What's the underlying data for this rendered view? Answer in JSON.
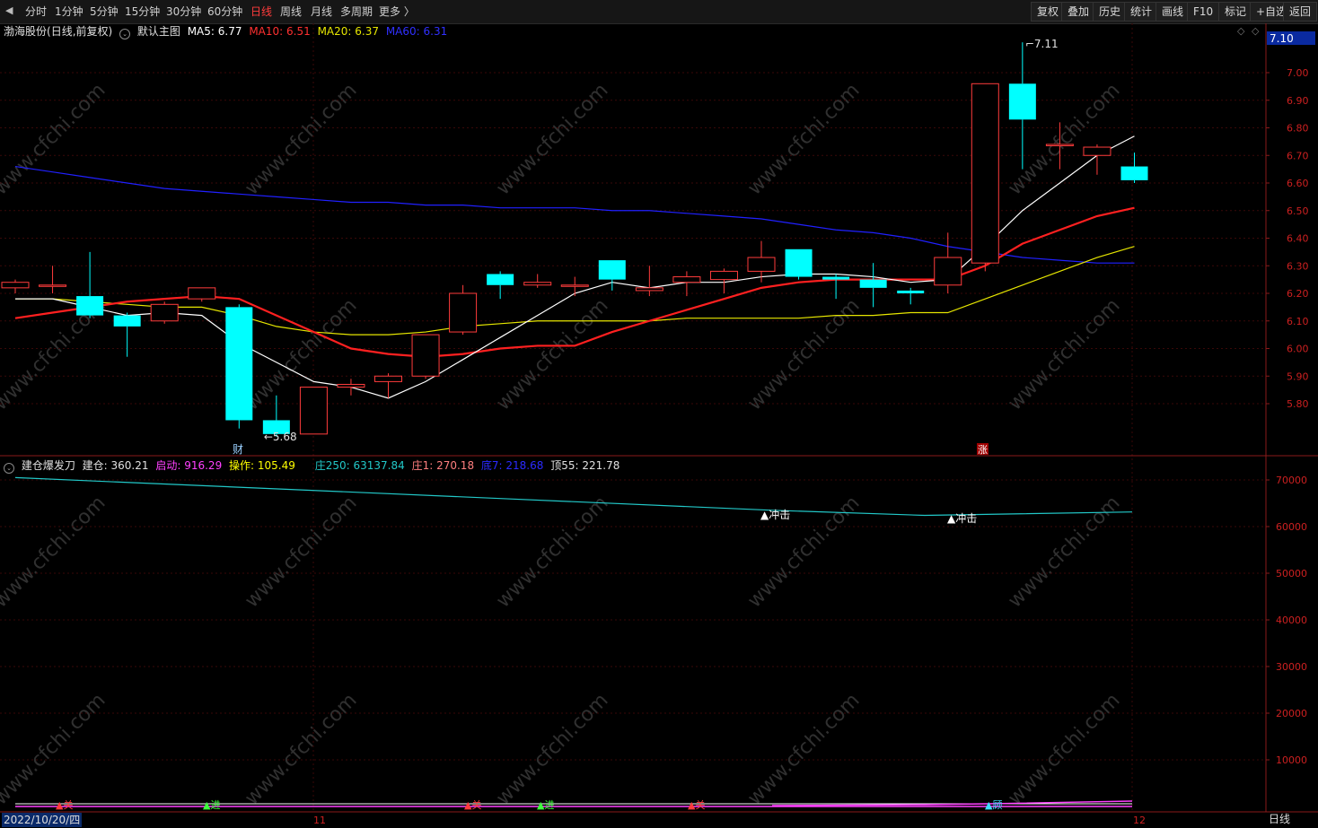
{
  "toolbar": {
    "back_icon": "triangle-left-icon",
    "periods": [
      "分时",
      "1分钟",
      "5分钟",
      "15分钟",
      "30分钟",
      "60分钟",
      "日线",
      "周线",
      "月线",
      "多周期",
      "更多 〉"
    ],
    "active_period": "日线",
    "right_buttons": [
      "复权",
      "叠加",
      "历史",
      "统计",
      "画线",
      "F10",
      "标记",
      "+自选",
      "返回"
    ]
  },
  "main_legend": {
    "stock": "渤海股份",
    "mode": "(日线,前复权)",
    "template": "默认主图",
    "ma5": "MA5: 6.77",
    "ma10": "MA10: 6.51",
    "ma20": "MA20: 6.37",
    "ma60": "MA60: 6.31"
  },
  "sub_legend": {
    "name": "建仓爆发刀",
    "jiancang": "建仓: 360.21",
    "qidong": "启动: 916.29",
    "caozuo": "操作: 105.49",
    "zhuang250": "庄250: 63137.84",
    "zhuang1": "庄1: 270.18",
    "di7": "底7: 218.68",
    "ding55": "顶55: 221.78"
  },
  "colors": {
    "up": "#ff3c3c",
    "down": "#00ffff",
    "ma5": "#ffffff",
    "ma10": "#ff2020",
    "ma20": "#e6e600",
    "ma60": "#2020ff",
    "axis": "#8a1a1a",
    "grid": "#3a0808",
    "zhuang250": "#22c8c8",
    "qidong": "#ff40ff",
    "caozuo": "#ffff00"
  },
  "price_axis": {
    "ticks": [
      "7.00",
      "6.90",
      "6.80",
      "6.70",
      "6.60",
      "6.50",
      "6.40",
      "6.30",
      "6.20",
      "6.10",
      "6.00",
      "5.90",
      "5.80"
    ],
    "current": "7.10"
  },
  "sub_axis": {
    "ticks": [
      "70000",
      "60000",
      "50000",
      "40000",
      "30000",
      "20000",
      "10000"
    ]
  },
  "annotations": {
    "high": "7.11",
    "low": "5.68",
    "cai": "财",
    "zhang": "涨",
    "chongji": "▲冲击"
  },
  "bottom_markers": [
    "▲关",
    "▲进",
    "▲关",
    "▲进",
    "▲关",
    "▲顾"
  ],
  "watermark": "www.cfchi.com",
  "date_axis": {
    "start": "2022/10/20/四",
    "nov": "11",
    "dec": "12"
  },
  "period_label": "日线",
  "chart_data": {
    "type": "candlestick",
    "candles": [
      {
        "o": 6.22,
        "c": 6.24,
        "h": 6.25,
        "l": 6.2
      },
      {
        "o": 6.23,
        "c": 6.23,
        "h": 6.3,
        "l": 6.2
      },
      {
        "o": 6.19,
        "c": 6.12,
        "h": 6.35,
        "l": 6.11
      },
      {
        "o": 6.12,
        "c": 6.08,
        "h": 6.13,
        "l": 5.97
      },
      {
        "o": 6.1,
        "c": 6.16,
        "h": 6.17,
        "l": 6.09
      },
      {
        "o": 6.18,
        "c": 6.22,
        "h": 6.22,
        "l": 6.17
      },
      {
        "o": 6.15,
        "c": 5.74,
        "h": 6.16,
        "l": 5.71
      },
      {
        "o": 5.74,
        "c": 5.69,
        "h": 5.83,
        "l": 5.68
      },
      {
        "o": 5.69,
        "c": 5.86,
        "h": 5.86,
        "l": 5.69
      },
      {
        "o": 5.86,
        "c": 5.87,
        "h": 5.89,
        "l": 5.83
      },
      {
        "o": 5.88,
        "c": 5.9,
        "h": 5.91,
        "l": 5.82
      },
      {
        "o": 5.9,
        "c": 6.05,
        "h": 6.05,
        "l": 5.89
      },
      {
        "o": 6.06,
        "c": 6.2,
        "h": 6.23,
        "l": 6.05
      },
      {
        "o": 6.27,
        "c": 6.23,
        "h": 6.28,
        "l": 6.18
      },
      {
        "o": 6.23,
        "c": 6.24,
        "h": 6.27,
        "l": 6.22
      },
      {
        "o": 6.23,
        "c": 6.23,
        "h": 6.26,
        "l": 6.19
      },
      {
        "o": 6.32,
        "c": 6.25,
        "h": 6.32,
        "l": 6.21
      },
      {
        "o": 6.21,
        "c": 6.22,
        "h": 6.3,
        "l": 6.19
      },
      {
        "o": 6.24,
        "c": 6.26,
        "h": 6.28,
        "l": 6.19
      },
      {
        "o": 6.25,
        "c": 6.28,
        "h": 6.29,
        "l": 6.2
      },
      {
        "o": 6.28,
        "c": 6.33,
        "h": 6.39,
        "l": 6.24
      },
      {
        "o": 6.36,
        "c": 6.26,
        "h": 6.36,
        "l": 6.25
      },
      {
        "o": 6.26,
        "c": 6.25,
        "h": 6.27,
        "l": 6.18
      },
      {
        "o": 6.25,
        "c": 6.22,
        "h": 6.31,
        "l": 6.15
      },
      {
        "o": 6.21,
        "c": 6.2,
        "h": 6.22,
        "l": 6.16
      },
      {
        "o": 6.23,
        "c": 6.33,
        "h": 6.42,
        "l": 6.2
      },
      {
        "o": 6.31,
        "c": 6.96,
        "h": 6.96,
        "l": 6.28
      },
      {
        "o": 6.96,
        "c": 6.83,
        "h": 7.11,
        "l": 6.65
      },
      {
        "o": 6.74,
        "c": 6.74,
        "h": 6.82,
        "l": 6.65
      },
      {
        "o": 6.7,
        "c": 6.73,
        "h": 6.74,
        "l": 6.63
      },
      {
        "o": 6.66,
        "c": 6.61,
        "h": 6.71,
        "l": 6.6
      }
    ],
    "ma5": [
      6.18,
      6.18,
      6.15,
      6.12,
      6.13,
      6.12,
      6.02,
      5.95,
      5.88,
      5.86,
      5.82,
      5.88,
      5.96,
      6.04,
      6.12,
      6.2,
      6.24,
      6.22,
      6.24,
      6.24,
      6.26,
      6.27,
      6.27,
      6.26,
      6.24,
      6.25,
      6.37,
      6.5,
      6.6,
      6.7,
      6.77
    ],
    "ma10": [
      6.11,
      6.13,
      6.15,
      6.17,
      6.18,
      6.19,
      6.18,
      6.12,
      6.06,
      6.0,
      5.98,
      5.97,
      5.98,
      6.0,
      6.01,
      6.01,
      6.06,
      6.1,
      6.14,
      6.18,
      6.22,
      6.24,
      6.25,
      6.25,
      6.25,
      6.25,
      6.3,
      6.38,
      6.43,
      6.48,
      6.51
    ],
    "ma20": [
      6.18,
      6.18,
      6.17,
      6.16,
      6.15,
      6.15,
      6.12,
      6.08,
      6.06,
      6.05,
      6.05,
      6.06,
      6.08,
      6.09,
      6.1,
      6.1,
      6.1,
      6.1,
      6.11,
      6.11,
      6.11,
      6.11,
      6.12,
      6.12,
      6.13,
      6.13,
      6.18,
      6.23,
      6.28,
      6.33,
      6.37
    ],
    "ma60": [
      6.66,
      6.64,
      6.62,
      6.6,
      6.58,
      6.57,
      6.56,
      6.55,
      6.54,
      6.53,
      6.53,
      6.52,
      6.52,
      6.51,
      6.51,
      6.51,
      6.5,
      6.5,
      6.49,
      6.48,
      6.47,
      6.45,
      6.43,
      6.42,
      6.4,
      6.37,
      6.35,
      6.33,
      6.32,
      6.31,
      6.31
    ],
    "zhuang250": [
      70500,
      63137.84
    ],
    "chongji_idx": [
      20,
      25
    ]
  }
}
